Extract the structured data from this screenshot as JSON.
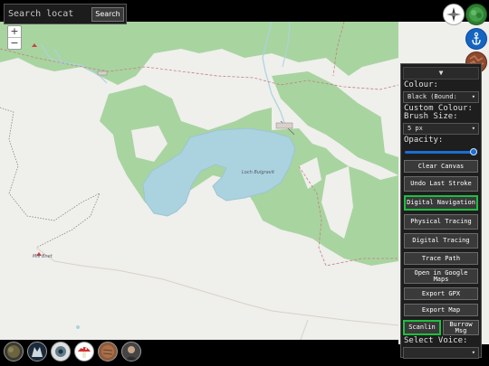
{
  "search": {
    "placeholder": "Search locat",
    "button_label": "Search"
  },
  "zoom": {
    "in_label": "+",
    "out_label": "−"
  },
  "map": {
    "lake_label": "Loch Bulgravit",
    "place_label": "Mill Bnet",
    "colors": {
      "forest": "#a8d4a0",
      "water": "#aad3df",
      "land": "#efefec"
    }
  },
  "top_icons": [
    "compass-icon",
    "tree-icon",
    "anchor-icon",
    "bark-texture-icon"
  ],
  "panel": {
    "collapse_label": "▼",
    "colour_label": "Colour:",
    "colour_value": "Black (Bound:",
    "custom_colour_label": "Custom Colour:",
    "brush_size_label": "Brush Size:",
    "brush_size_value": "5 px",
    "opacity_label": "Opacity:",
    "opacity_value": 1.0,
    "buttons": [
      {
        "label": "Clear Canvas",
        "active": false
      },
      {
        "label": "Undo Last Stroke",
        "active": false
      },
      {
        "label": "Digital Navigation",
        "active": true
      },
      {
        "label": "Physical Tracing",
        "active": false
      },
      {
        "label": "Digital Tracing",
        "active": false
      },
      {
        "label": "Trace Path",
        "active": false
      },
      {
        "label": "Open in Google Maps",
        "active": false
      },
      {
        "label": "Export GPX",
        "active": false
      },
      {
        "label": "Export Map",
        "active": false
      }
    ],
    "scanline_label": "Scanlin",
    "burrow_label": "Burrow Msg",
    "select_voice_label": "Select Voice:",
    "voice_value": ""
  },
  "bottom_avatars": [
    "tree-canopy-avatar",
    "wolf-avatar",
    "eye-avatar",
    "mushroom-avatar",
    "bark-avatar",
    "person-avatar"
  ]
}
